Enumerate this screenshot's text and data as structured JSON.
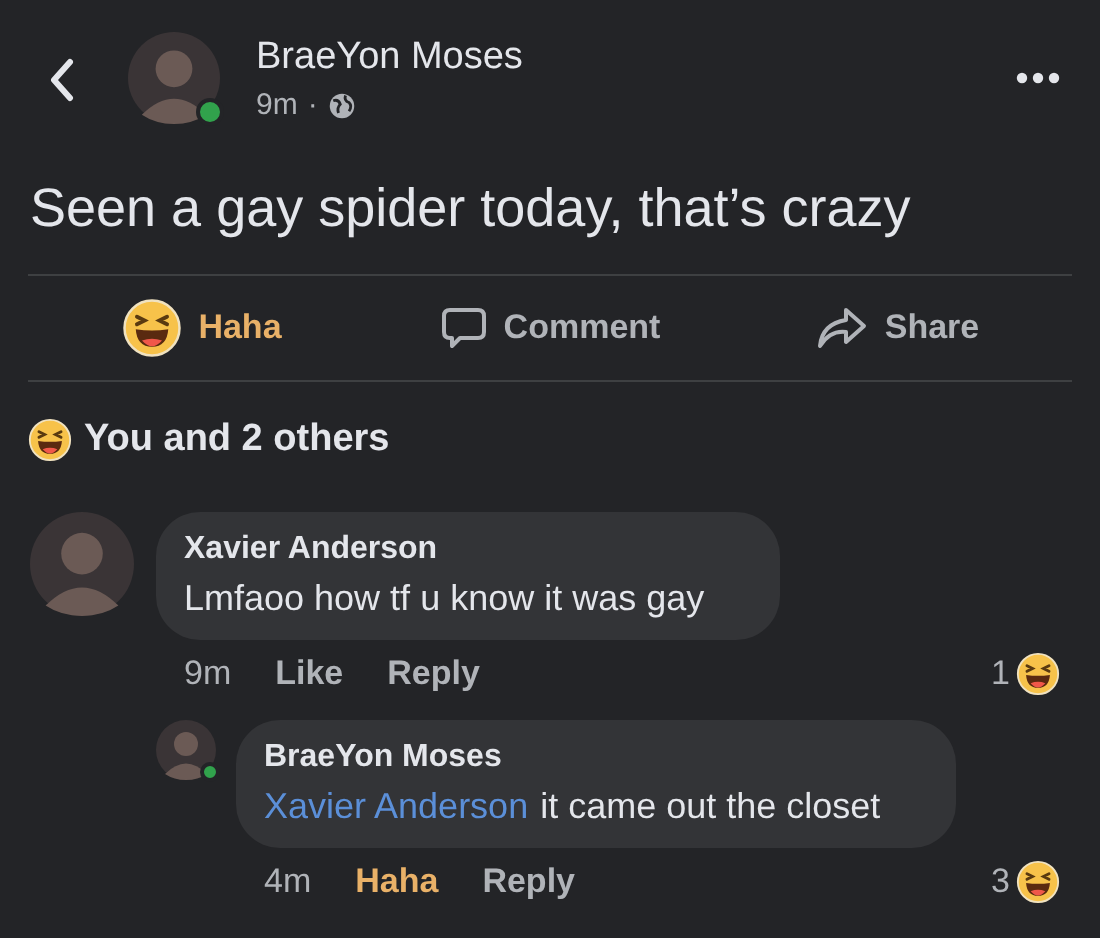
{
  "post": {
    "author": "BraeYon Moses",
    "online": true,
    "time": "9m",
    "separator": "·",
    "text": "Seen a gay spider today, that’s crazy"
  },
  "actions": [
    {
      "kind": "react",
      "label": "Haha",
      "reacted": true
    },
    {
      "kind": "comment",
      "label": "Comment"
    },
    {
      "kind": "share",
      "label": "Share"
    }
  ],
  "reactions_summary": "You and 2 others",
  "comments": [
    {
      "author": "Xavier Anderson",
      "online": false,
      "text": "Lmfaoo how tf u know it was gay",
      "time": "9m",
      "react_label": "Like",
      "reacted": false,
      "reply_label": "Reply",
      "reaction_count": "1",
      "replies": [
        {
          "author": "BraeYon Moses",
          "online": true,
          "mention": "Xavier Anderson",
          "text": "it came out the closet",
          "time": "4m",
          "react_label": "Haha",
          "reacted": true,
          "reply_label": "Reply",
          "reaction_count": "3"
        }
      ]
    }
  ]
}
